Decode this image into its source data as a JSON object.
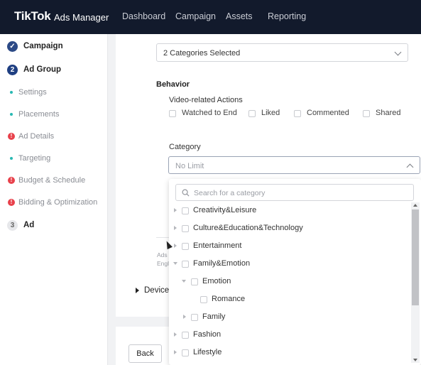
{
  "header": {
    "brand": "TikTok",
    "brand_sub": "Ads Manager",
    "nav": [
      "Dashboard",
      "Campaign",
      "Assets",
      "Reporting"
    ]
  },
  "sidebar": {
    "steps": [
      {
        "label": "Campaign",
        "badge": "✓",
        "state": "done"
      },
      {
        "label": "Ad Group",
        "badge": "2",
        "state": "active"
      },
      {
        "label": "Ad",
        "badge": "3",
        "state": "pending"
      }
    ],
    "sub_items": [
      {
        "label": "Settings",
        "status": "ok"
      },
      {
        "label": "Placements",
        "status": "ok"
      },
      {
        "label": "Ad Details",
        "status": "error"
      },
      {
        "label": "Targeting",
        "status": "ok"
      },
      {
        "label": "Budget & Schedule",
        "status": "error"
      },
      {
        "label": "Bidding & Optimization",
        "status": "error"
      }
    ],
    "error_glyph": "!"
  },
  "main": {
    "categories_select": "2 Categories Selected",
    "behavior_title": "Behavior",
    "video_actions_title": "Video-related Actions",
    "video_actions": [
      "Watched to End",
      "Liked",
      "Commented",
      "Shared"
    ],
    "category_title": "Category",
    "category_value": "No Limit",
    "faint_text_1": "Ads",
    "faint_text_2": "Engl",
    "device_label": "Device",
    "back_label": "Back"
  },
  "dropdown": {
    "search_placeholder": "Search for a category",
    "items": [
      {
        "label": "Creativity&Leisure",
        "level": 0,
        "arrow": "right"
      },
      {
        "label": "Culture&Education&Technology",
        "level": 0,
        "arrow": "right"
      },
      {
        "label": "Entertainment",
        "level": 0,
        "arrow": "right"
      },
      {
        "label": "Family&Emotion",
        "level": 0,
        "arrow": "down"
      },
      {
        "label": "Emotion",
        "level": 1,
        "arrow": "down"
      },
      {
        "label": "Romance",
        "level": 2,
        "arrow": "none"
      },
      {
        "label": "Family",
        "level": 1,
        "arrow": "right"
      },
      {
        "label": "Fashion",
        "level": 0,
        "arrow": "right"
      },
      {
        "label": "Lifestyle",
        "level": 0,
        "arrow": "right"
      }
    ]
  },
  "colors": {
    "header_bg": "#121a2c",
    "step_done": "#2c4a86",
    "ok_dot": "#28b8b3",
    "error": "#e8414b"
  }
}
